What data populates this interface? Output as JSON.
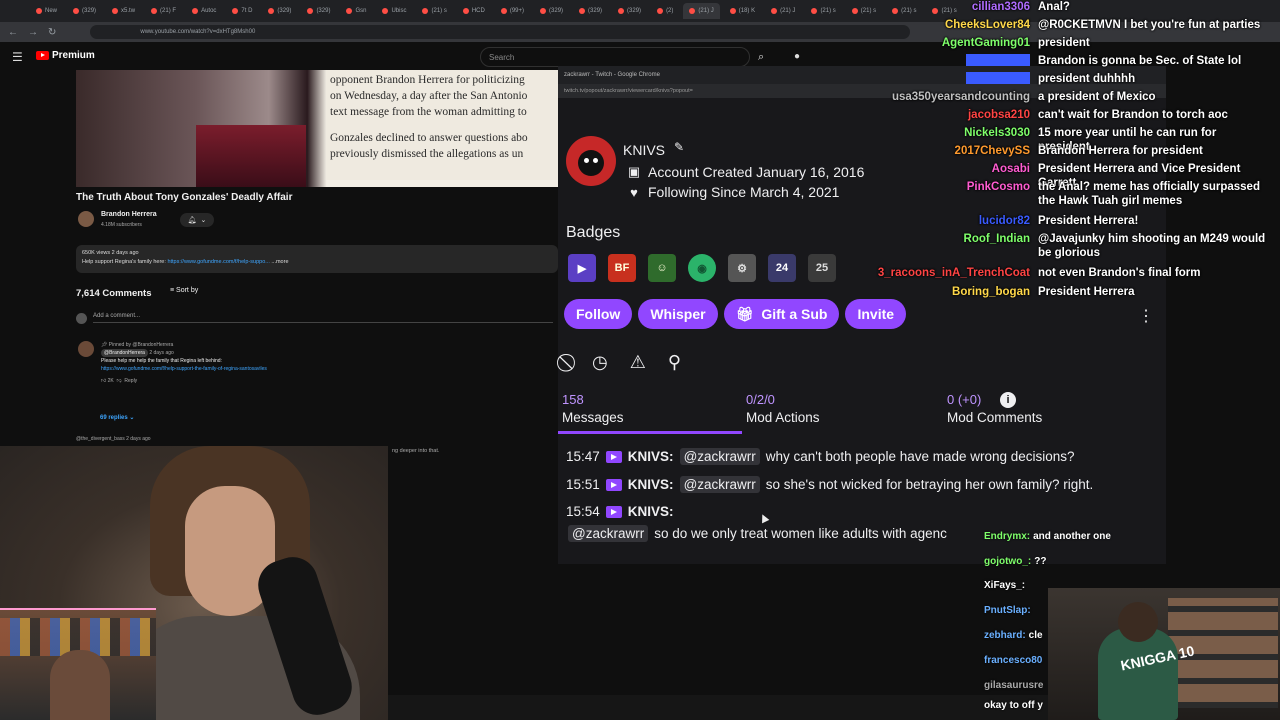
{
  "browser": {
    "tabs": [
      "New",
      "(329)",
      "x5.tw",
      "(21) F",
      "Autoc",
      "7t D",
      "(329)",
      "(329)",
      "Gsn",
      "Ubisc",
      "(21) s",
      "HCD",
      "(99+)",
      "(329)",
      "(329)",
      "(329)",
      "(2)",
      "(21) J",
      "(18) K",
      "(21) J",
      "(21) s",
      "(21) s",
      "(21) s",
      "(21) s"
    ],
    "url": "www.youtube.com/watch?v=dxHTg8Msh00"
  },
  "youtube": {
    "logo": "Premium",
    "search_placeholder": "Search",
    "article_lines": [
      "opponent Brandon Herrera for politicizing",
      "on Wednesday, a day after the San Antonio",
      "text message from the woman admitting to",
      "Gonzales declined to answer questions abo",
      "previously dismissed the allegations as un"
    ],
    "video_title": "The Truth About Tony Gonzales' Deadly Affair",
    "channel_name": "Brandon Herrera",
    "channel_subs": "4.18M subscribers",
    "desc_stats": "650K views  2 days ago",
    "desc_text": "Help support Regina's family here: ",
    "desc_link": "https://www.gofundme.com/f/help-suppo...",
    "desc_more": "...more",
    "comments_count": "7,614 Comments",
    "sort_label": "Sort by",
    "add_comment_placeholder": "Add a comment...",
    "pinned_label": "Pinned by @BrandonHerrera",
    "pinned_author": "@BrandonHerrera",
    "pinned_time": "2 days ago",
    "pinned_text": "Please help me help the family that Regina left behind:",
    "pinned_link": "https://www.gofundme.com/f/help-support-the-family-of-regina-santosaviles",
    "pinned_likes": "2K",
    "reply_label": "Reply",
    "replies_label": "69 replies",
    "next_comment_author": "@the_divergent_bass",
    "next_comment_time": "2 days ago",
    "hidden_tail": "ng deeper into that."
  },
  "popout": {
    "window_title": "zackrawrr - Twitch - Google Chrome",
    "url": "twitch.tv/popout/zackrawrr/viewercard/knivs?popout=",
    "username": "KNIVS",
    "account_created": "Account Created January 16, 2016",
    "following_since": "Following Since March 4, 2021",
    "badges_title": "Badges",
    "badges": [
      "▶",
      "BF",
      "☺",
      "◉",
      "⚙",
      "24",
      "25"
    ],
    "buttons": [
      "Follow",
      "Whisper",
      "Gift a Sub",
      "Invite"
    ],
    "stats": [
      {
        "num": "158",
        "label": "Messages"
      },
      {
        "num": "0/2/0",
        "label": "Mod Actions"
      },
      {
        "num": "0 (+0)",
        "label": "Mod Comments"
      }
    ],
    "messages": [
      {
        "time": "15:47",
        "user": "KNIVS:",
        "mention": "@zackrawrr",
        "text": "why can't both people have made wrong decisions?"
      },
      {
        "time": "15:51",
        "user": "KNIVS:",
        "mention": "@zackrawrr",
        "text": "so she's not wicked for betraying her own family? right."
      },
      {
        "time": "15:54",
        "user": "KNIVS:",
        "mention": "@zackrawrr",
        "text": "so do we only treat women like adults with agenc"
      }
    ]
  },
  "chat": [
    {
      "name": "cillian3306",
      "color": "#b06cff",
      "text": "Anal?"
    },
    {
      "name": "CheeksLover84",
      "color": "#ffd84a",
      "text": "@R0CKETMVN I bet you're fun at parties"
    },
    {
      "name": "AgentGaming01",
      "color": "#7fff6b",
      "text": "president"
    },
    {
      "name": "",
      "color": "#3a5bff",
      "text": "Brandon is gonna be Sec. of State lol"
    },
    {
      "name": "",
      "color": "#3a5bff",
      "text": "president duhhhh"
    },
    {
      "name": "usa350yearsandcounting",
      "color": "#c0c0c0",
      "text": "a president of Mexico"
    },
    {
      "name": "jacobsa210",
      "color": "#ff4444",
      "text": "can't wait for Brandon to torch aoc"
    },
    {
      "name": "Nickels3030",
      "color": "#7fff6b",
      "text": "15 more year until he can run for president"
    },
    {
      "name": "2017ChevySS",
      "color": "#ff9a2e",
      "text": "Brandon Herrera for president"
    },
    {
      "name": "Aosabi",
      "color": "#ff5cd1",
      "text": "President Herrera and Vice President Garrett"
    },
    {
      "name": "PinkCosmo",
      "color": "#ff5cd1",
      "text": "the Anal? meme has officially surpassed the Hawk Tuah girl memes"
    },
    {
      "name": "lucidor82",
      "color": "#3a5bff",
      "text": "President Herrera!"
    },
    {
      "name": "Roof_Indian",
      "color": "#7fff6b",
      "text": "@Javajunky him shooting an M249 would be glorious"
    },
    {
      "name": "3_racoons_inA_TrenchCoat",
      "color": "#ff4444",
      "text": "not even Brandon's final form"
    },
    {
      "name": "Boring_bogan",
      "color": "#ffd84a",
      "text": "President Herrera"
    }
  ],
  "lower_chat": [
    {
      "name": "Endrymx:",
      "color": "#7fff6b",
      "text": "and another one"
    },
    {
      "name": "gojotwo_:",
      "color": "#7fff6b",
      "text": "??"
    },
    {
      "name": "XiFays_:",
      "color": "#ffffff",
      "text": ""
    },
    {
      "name": "PnutSlap:",
      "color": "#6bb0ff",
      "text": ""
    },
    {
      "name": "zebhard:",
      "color": "#6bb0ff",
      "text": "cle"
    },
    {
      "name": "francesco80",
      "color": "#6bb0ff",
      "text": ""
    },
    {
      "name": "gilasaurusre",
      "color": "#aaaaaa",
      "text": ""
    },
    {
      "name": "okay to off y",
      "color": "#ffffff",
      "text": ""
    }
  ],
  "cam_jersey": "KNIGGA 10",
  "colors": {
    "twitch_purple": "#9147ff",
    "twitch_bg": "#18181b",
    "yt_red": "#ff0000"
  }
}
